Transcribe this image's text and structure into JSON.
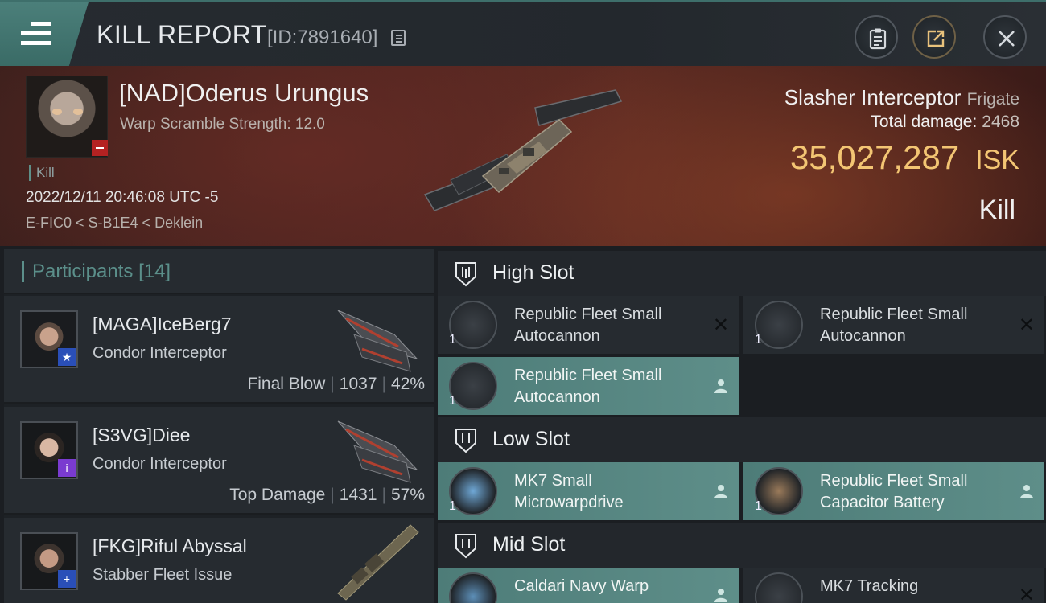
{
  "header": {
    "title": "KILL REPORT",
    "report_id": "[ID:7891640]"
  },
  "victim": {
    "name": "[NAD]Oderus Urungus",
    "scramble": "Warp Scramble Strength: 12.0",
    "kill_tag": "Kill",
    "datetime": "2022/12/11 20:46:08 UTC -5",
    "location": "E-FIC0 < S-B1E4 < Deklein",
    "ship": "Slasher Interceptor",
    "ship_class": "Frigate",
    "damage_label": "Total damage:",
    "damage_value": "2468",
    "isk_value": "35,027,287",
    "isk_unit": "ISK",
    "result": "Kill"
  },
  "participants": {
    "label": "Participants",
    "count": "[14]",
    "items": [
      {
        "name": "[MAGA]IceBerg7",
        "ship": "Condor Interceptor",
        "role": "Final Blow",
        "damage": "1037",
        "percent": "42%",
        "badge_color": "#2a4fb8",
        "badge_icon": "star-icon"
      },
      {
        "name": "[S3VG]Diee",
        "ship": "Condor Interceptor",
        "role": "Top Damage",
        "damage": "1431",
        "percent": "57%",
        "badge_color": "#7a3bd0",
        "badge_icon": "info-icon"
      },
      {
        "name": "[FKG]Riful Abyssal",
        "ship": "Stabber Fleet Issue",
        "role": "",
        "damage": "",
        "percent": "",
        "badge_color": "#2a4fb8",
        "badge_icon": "plus-icon"
      }
    ]
  },
  "fitting": {
    "high_slot": {
      "label": "High Slot",
      "modules": [
        {
          "name_line1": "Republic Fleet Small",
          "name_line2": "Autocannon",
          "qty": "1",
          "status": "destroyed"
        },
        {
          "name_line1": "Republic Fleet Small",
          "name_line2": "Autocannon",
          "qty": "1",
          "status": "destroyed"
        },
        {
          "name_line1": "Republic Fleet Small",
          "name_line2": "Autocannon",
          "qty": "1",
          "status": "dropped"
        }
      ]
    },
    "low_slot": {
      "label": "Low Slot",
      "modules": [
        {
          "name_line1": "MK7 Small",
          "name_line2": "Microwarpdrive",
          "qty": "1",
          "status": "dropped"
        },
        {
          "name_line1": "Republic Fleet Small",
          "name_line2": "Capacitor Battery",
          "qty": "1",
          "status": "dropped"
        }
      ]
    },
    "mid_slot": {
      "label": "Mid Slot",
      "modules": [
        {
          "name_line1": "Caldari Navy Warp",
          "name_line2": "",
          "qty": "",
          "status": "dropped"
        },
        {
          "name_line1": "MK7 Tracking",
          "name_line2": "",
          "qty": "",
          "status": "destroyed"
        }
      ]
    }
  },
  "colors": {
    "accent_teal": "#5b8f8a",
    "isk_gold": "#f3c573",
    "dropped_highlight": "#5e8e89"
  }
}
